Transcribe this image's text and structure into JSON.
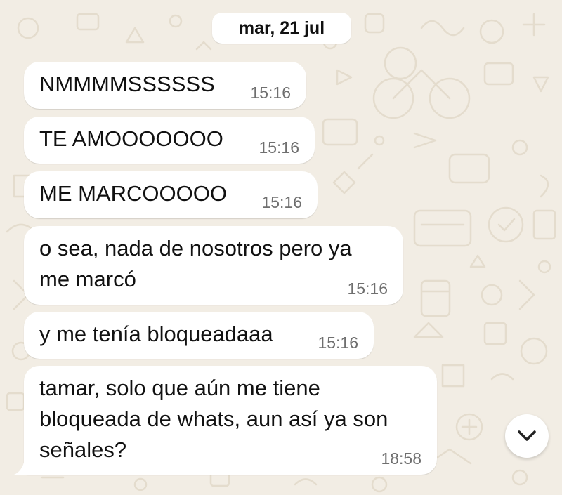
{
  "chat": {
    "date_separator": "mar, 21 jul",
    "messages": [
      {
        "text": "NMMMMSSSSSS",
        "time": "15:16"
      },
      {
        "text": "TE AMOOOOOOO",
        "time": "15:16"
      },
      {
        "text": "ME MARCOOOOO",
        "time": "15:16"
      },
      {
        "lines": [
          "o sea, nada de nosotros pero ya",
          "me marcó"
        ],
        "time": "15:16"
      },
      {
        "text": "y me tenía bloqueadaaa",
        "time": "15:16"
      },
      {
        "lines": [
          "tamar, solo que aún me tiene",
          "bloqueada de whats, aun así ya son",
          "señales?"
        ],
        "time": "18:58"
      }
    ]
  },
  "controls": {
    "scroll_down_icon": "chevron-down-icon"
  },
  "colors": {
    "background": "#f2ede4",
    "bubble": "#ffffff",
    "timestamp": "#6f6f6f"
  }
}
